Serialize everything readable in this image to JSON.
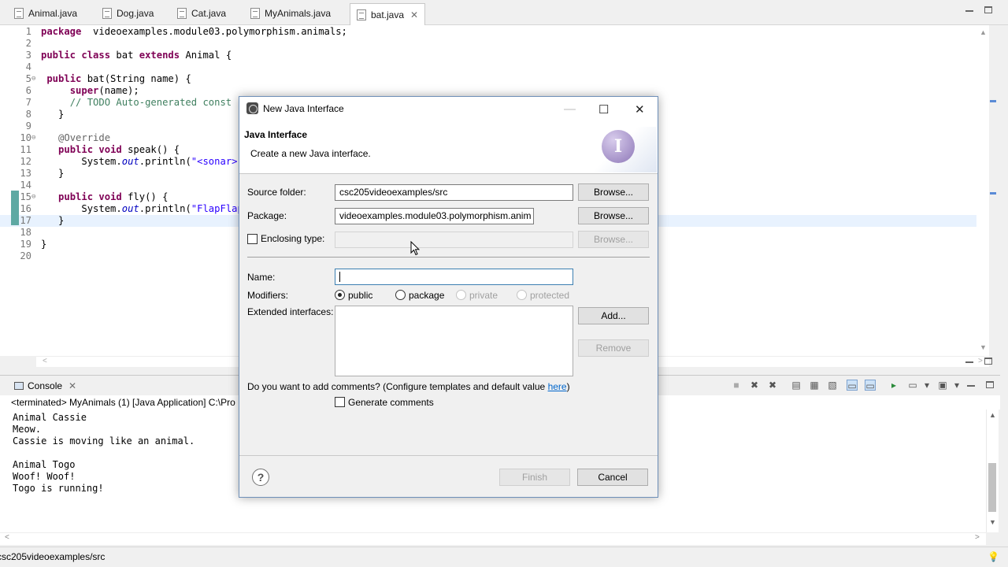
{
  "editor": {
    "tabs": [
      {
        "label": "Animal.java"
      },
      {
        "label": "Dog.java"
      },
      {
        "label": "Cat.java"
      },
      {
        "label": "MyAnimals.java"
      },
      {
        "label": "bat.java",
        "close": "✕"
      }
    ],
    "lines": [
      {
        "n": "1",
        "parts": [
          [
            "kw",
            "package"
          ],
          [
            "",
            "  videoexamples.module03.polymorphism.animals;"
          ]
        ]
      },
      {
        "n": "2",
        "parts": []
      },
      {
        "n": "3",
        "parts": [
          [
            "kw",
            "public"
          ],
          [
            "",
            " "
          ],
          [
            "kw",
            "class"
          ],
          [
            "",
            " bat "
          ],
          [
            "kw",
            "extends"
          ],
          [
            "",
            " Animal {"
          ]
        ]
      },
      {
        "n": "4",
        "parts": []
      },
      {
        "n": "5",
        "parts": [
          [
            "",
            " "
          ],
          [
            "kw",
            "public"
          ],
          [
            "",
            " bat(String name) {"
          ]
        ]
      },
      {
        "n": "6",
        "parts": [
          [
            "",
            "     "
          ],
          [
            "kw",
            "super"
          ],
          [
            "",
            "(name);"
          ]
        ]
      },
      {
        "n": "7",
        "parts": [
          [
            "",
            "     "
          ],
          [
            "cm",
            "// TODO Auto-generated const"
          ]
        ]
      },
      {
        "n": "8",
        "parts": [
          [
            "",
            "   }"
          ]
        ]
      },
      {
        "n": "9",
        "parts": []
      },
      {
        "n": "10",
        "parts": [
          [
            "",
            "   "
          ],
          [
            "an",
            "@Override"
          ]
        ]
      },
      {
        "n": "11",
        "parts": [
          [
            "",
            "   "
          ],
          [
            "kw",
            "public"
          ],
          [
            "",
            " "
          ],
          [
            "kw",
            "void"
          ],
          [
            "",
            " speak() {"
          ]
        ]
      },
      {
        "n": "12",
        "parts": [
          [
            "",
            "       System."
          ],
          [
            "it",
            "out"
          ],
          [
            "",
            ".println("
          ],
          [
            "st",
            "\"<sonar>\""
          ]
        ]
      },
      {
        "n": "13",
        "parts": [
          [
            "",
            "   }"
          ]
        ]
      },
      {
        "n": "14",
        "parts": []
      },
      {
        "n": "15",
        "parts": [
          [
            "",
            "   "
          ],
          [
            "kw",
            "public"
          ],
          [
            "",
            " "
          ],
          [
            "kw",
            "void"
          ],
          [
            "",
            " fly() {"
          ]
        ]
      },
      {
        "n": "16",
        "parts": [
          [
            "",
            "       System."
          ],
          [
            "it",
            "out"
          ],
          [
            "",
            ".println("
          ],
          [
            "st",
            "\"FlapFlap"
          ]
        ]
      },
      {
        "n": "17",
        "parts": [
          [
            "",
            "   }"
          ]
        ]
      },
      {
        "n": "18",
        "parts": []
      },
      {
        "n": "19",
        "parts": [
          [
            "",
            "}"
          ]
        ]
      },
      {
        "n": "20",
        "parts": []
      }
    ]
  },
  "console": {
    "title": "Console",
    "close": "✕",
    "status": "<terminated> MyAnimals (1) [Java Application] C:\\Pro",
    "output": [
      "Animal Cassie",
      "Meow.",
      "Cassie is moving like an animal.",
      "",
      "Animal Togo",
      "Woof! Woof!",
      "Togo is running!"
    ]
  },
  "statusbar": {
    "text": "csc205videoexamples/src"
  },
  "dialog": {
    "title": "New Java Interface",
    "heading": "Java Interface",
    "description": "Create a new Java interface.",
    "wizard_icon_letter": "I",
    "source_folder": {
      "label": "Source folder:",
      "value": "csc205videoexamples/src",
      "browse": "Browse..."
    },
    "package": {
      "label": "Package:",
      "value": "videoexamples.module03.polymorphism.anim",
      "browse": "Browse..."
    },
    "enclosing_type": {
      "label": "Enclosing type:",
      "value": "",
      "browse": "Browse...",
      "checked": false
    },
    "name": {
      "label": "Name:",
      "value": ""
    },
    "modifiers": {
      "label": "Modifiers:",
      "options": [
        {
          "label": "public",
          "selected": true,
          "enabled": true
        },
        {
          "label": "package",
          "selected": false,
          "enabled": true
        },
        {
          "label": "private",
          "selected": false,
          "enabled": false
        },
        {
          "label": "protected",
          "selected": false,
          "enabled": false
        }
      ]
    },
    "extended_interfaces": {
      "label": "Extended interfaces:",
      "add": "Add...",
      "remove": "Remove"
    },
    "comments": {
      "question": "Do you want to add comments? (Configure templates and default value ",
      "link": "here",
      "close_paren": ")",
      "checkbox_label": "Generate comments",
      "checked": false
    },
    "help": "?",
    "finish": "Finish",
    "cancel": "Cancel",
    "controls": {
      "minimize": "—",
      "maximize": "☐",
      "close": "✕"
    }
  },
  "colors": {
    "keyword": "#7f0055",
    "comment": "#3f7f5f",
    "string": "#2a00ff",
    "link": "#0066cc",
    "current_line": "#e8f2fe"
  }
}
